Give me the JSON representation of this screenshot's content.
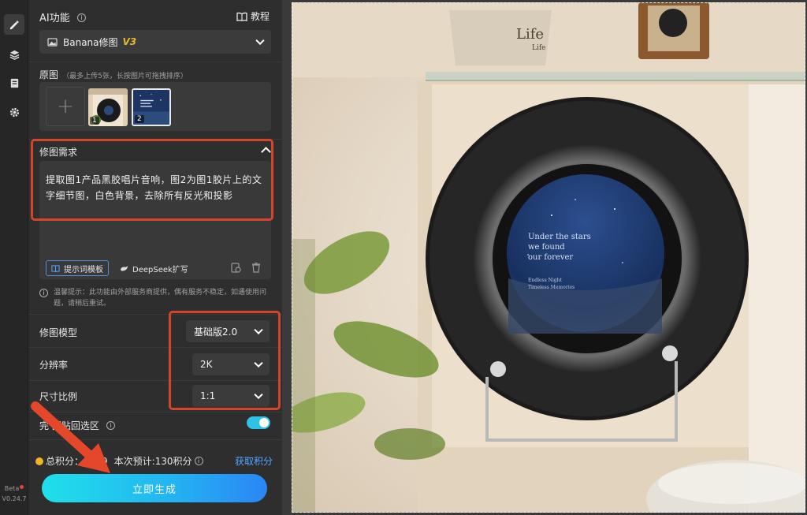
{
  "panel": {
    "title": "AI功能",
    "tutorial": "教程",
    "model_select": {
      "name": "Banana修图",
      "version": "V3"
    },
    "original": {
      "label": "原图",
      "hint": "（最多上传5张，长按图片可拖拽排序）",
      "thumbs": [
        "1",
        "2"
      ]
    },
    "request": {
      "label": "修图需求",
      "text": "提取图1产品黑胶唱片音响，图2为图1胶片上的文字细节图，白色背景，去除所有反光和投影",
      "template_btn": "提示词模板",
      "deepseek_btn": "DeepSeek扩写"
    },
    "notice": "温馨提示：此功能由外部服务商提供，偶有服务不稳定，如遇使用问题，请稍后重试。",
    "settings": [
      {
        "label": "修图模型",
        "value": "基础版2.0"
      },
      {
        "label": "分辨率",
        "value": "2K"
      },
      {
        "label": "尺寸比例",
        "value": "1:1"
      }
    ],
    "paste_back": {
      "label": "完成图贴回选区",
      "visible": "完  图贴回选区"
    },
    "points": {
      "total_label": "总积分：",
      "total_partial": "1  79",
      "estimate": "本次预计:130积分",
      "get": "获取积分"
    },
    "generate": "立即生成"
  },
  "rail": {
    "beta": "Beta",
    "version": "V0.24.7"
  },
  "photo": {
    "disc_text": [
      "Under the stars",
      "we found",
      "our forever"
    ],
    "disc_small": [
      "Endless Night",
      "Timeless Memories"
    ],
    "pot_text": [
      "Life",
      "Life"
    ]
  },
  "colors": {
    "accent": "#2ec3e6",
    "annotation": "#d5452c",
    "link": "#4fa8ff",
    "v3": "#e8b829"
  }
}
